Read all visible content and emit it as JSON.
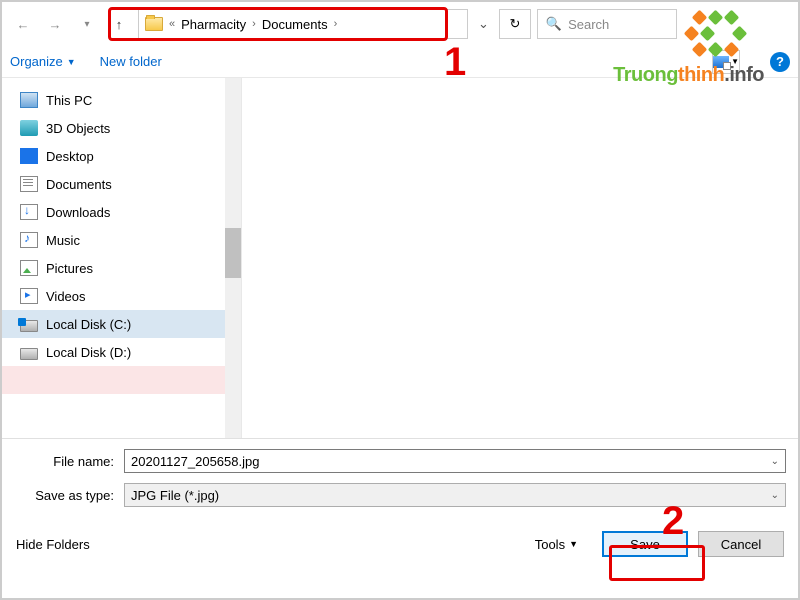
{
  "address": {
    "crumb1": "Pharmacity",
    "crumb2": "Documents"
  },
  "search": {
    "placeholder": "Search"
  },
  "toolbar": {
    "organize": "Organize",
    "new_folder": "New folder"
  },
  "sidebar": {
    "items": [
      {
        "label": "This PC",
        "icon": "pc"
      },
      {
        "label": "3D Objects",
        "icon": "3d"
      },
      {
        "label": "Desktop",
        "icon": "desk"
      },
      {
        "label": "Documents",
        "icon": "doc"
      },
      {
        "label": "Downloads",
        "icon": "dl"
      },
      {
        "label": "Music",
        "icon": "music"
      },
      {
        "label": "Pictures",
        "icon": "pic"
      },
      {
        "label": "Videos",
        "icon": "vid"
      },
      {
        "label": "Local Disk (C:)",
        "icon": "diskc",
        "selected": true
      },
      {
        "label": "Local Disk (D:)",
        "icon": "disk"
      }
    ]
  },
  "form": {
    "filename_label": "File name:",
    "filename_value": "20201127_205658.jpg",
    "type_label": "Save as type:",
    "type_value": "JPG File (*.jpg)"
  },
  "footer": {
    "hide_folders": "Hide Folders",
    "tools": "Tools",
    "save": "Save",
    "cancel": "Cancel"
  },
  "annotations": {
    "one": "1",
    "two": "2"
  },
  "watermark": {
    "brand1": "Truong",
    "brand2": "thinh",
    "brand3": ".info"
  }
}
